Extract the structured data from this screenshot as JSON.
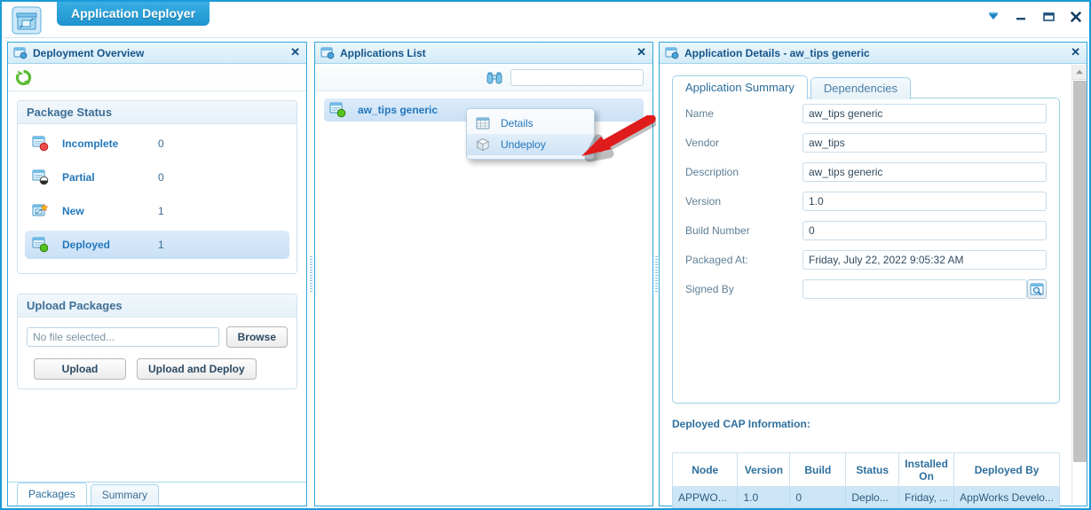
{
  "window": {
    "app_icon": "package-box-icon",
    "title": "Application Deployer",
    "controls": [
      {
        "name": "dropdown-pin-button",
        "icon": "chevron-down-filled-icon"
      },
      {
        "name": "minimize-button",
        "icon": "minimize-icon"
      },
      {
        "name": "maximize-button",
        "icon": "maximize-icon"
      },
      {
        "name": "close-button",
        "icon": "close-icon"
      }
    ]
  },
  "deployment_overview": {
    "title": "Deployment Overview",
    "icon": "panel-window-icon",
    "close_icon": "close-icon",
    "refresh_icon": "refresh-icon",
    "package_status": {
      "heading": "Package Status",
      "rows": [
        {
          "icon": "package-incomplete-icon",
          "label": "Incomplete",
          "count": "0",
          "selected": false
        },
        {
          "icon": "package-partial-icon",
          "label": "Partial",
          "count": "0",
          "selected": false
        },
        {
          "icon": "package-new-icon",
          "label": "New",
          "count": "1",
          "selected": false
        },
        {
          "icon": "package-deployed-icon",
          "label": "Deployed",
          "count": "1",
          "selected": true
        }
      ]
    },
    "upload_packages": {
      "heading": "Upload Packages",
      "file_value": "No file selected...",
      "browse_label": "Browse",
      "upload_label": "Upload",
      "upload_deploy_label": "Upload and Deploy"
    },
    "tabs": [
      {
        "label": "Packages",
        "active": true
      },
      {
        "label": "Summary",
        "active": false
      }
    ]
  },
  "applications_list": {
    "title": "Applications List",
    "icon": "panel-window-icon",
    "close_icon": "close-icon",
    "search_icon": "binoculars-icon",
    "search_value": "",
    "items": [
      {
        "icon": "package-deployed-icon",
        "label": "aw_tips generic",
        "selected": true
      }
    ],
    "context_menu": [
      {
        "icon": "grid-table-icon",
        "label": "Details",
        "highlighted": false
      },
      {
        "icon": "cube-icon",
        "label": "Undeploy",
        "highlighted": true
      }
    ]
  },
  "application_details": {
    "title": "Application Details - aw_tips generic",
    "icon": "panel-window-icon",
    "close_icon": "close-icon",
    "tabs": [
      {
        "label": "Application Summary",
        "active": true
      },
      {
        "label": "Dependencies",
        "active": false
      }
    ],
    "fields": [
      {
        "label": "Name",
        "value": "aw_tips generic",
        "lookup": false
      },
      {
        "label": "Vendor",
        "value": "aw_tips",
        "lookup": false
      },
      {
        "label": "Description",
        "value": "aw_tips generic",
        "lookup": false
      },
      {
        "label": "Version",
        "value": "1.0",
        "lookup": false
      },
      {
        "label": "Build Number",
        "value": "0",
        "lookup": false
      },
      {
        "label": "Packaged At:",
        "value": "Friday, July 22, 2022 9:05:32 AM",
        "lookup": false
      },
      {
        "label": "Signed By",
        "value": "",
        "lookup": true,
        "lookup_icon": "search-window-icon"
      }
    ],
    "cap_info": {
      "heading": "Deployed CAP Information:",
      "columns": [
        "Node",
        "Version",
        "Build",
        "Status",
        "Installed On",
        "Deployed By"
      ],
      "rows": [
        [
          "APPWO...",
          "1.0",
          "0",
          "Deplo...",
          "Friday, ...",
          "AppWorks Develo..."
        ]
      ]
    },
    "scrollbar": {
      "up_icon": "scroll-up-arrow-icon"
    }
  },
  "annotation": {
    "arrow": "red-arrow-pointing-to-undeploy"
  },
  "colors": {
    "accent": "#1f93ce",
    "panel_border": "#2fa5dd",
    "link_blue": "#2277bb",
    "header_blue": "#15548a",
    "selection": "#cbe1f6",
    "arrow_red": "#e01b1b"
  }
}
